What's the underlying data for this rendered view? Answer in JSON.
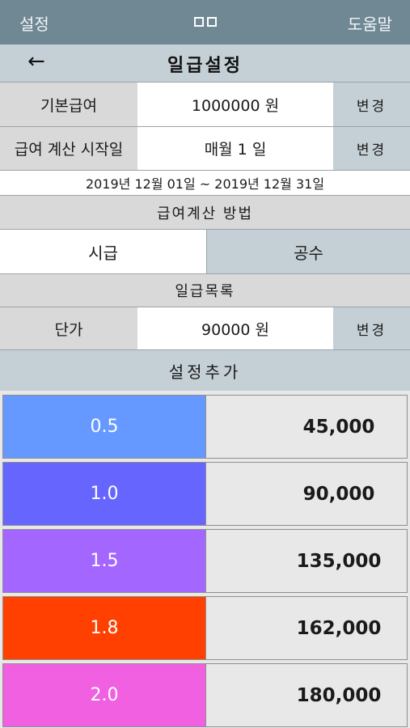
{
  "topbar": {
    "left_label": "설정",
    "right_label": "도움말"
  },
  "navbar": {
    "back_icon": "←",
    "title": "일급설정"
  },
  "base_pay": {
    "label": "기본급여",
    "value": "1000000 원",
    "button": "변경"
  },
  "pay_start": {
    "label": "급여 계산 시작일",
    "value": "매월 1 일",
    "button": "변경"
  },
  "period": "2019년 12월 01일 ~ 2019년 12월 31일",
  "method": {
    "header": "급여계산 방법",
    "options": [
      "시급",
      "공수"
    ],
    "selected": "시급"
  },
  "daily_list": {
    "header": "일급목록"
  },
  "unit_price": {
    "label": "단가",
    "value": "90000 원",
    "button": "변경"
  },
  "add_setting": "설정추가",
  "entries": [
    {
      "rate": "0.5",
      "amount": "45,000",
      "color": "#6699ff"
    },
    {
      "rate": "1.0",
      "amount": "90,000",
      "color": "#6666ff"
    },
    {
      "rate": "1.5",
      "amount": "135,000",
      "color": "#a366ff"
    },
    {
      "rate": "1.8",
      "amount": "162,000",
      "color": "#ff4000"
    },
    {
      "rate": "2.0",
      "amount": "180,000",
      "color": "#f060e0"
    }
  ]
}
